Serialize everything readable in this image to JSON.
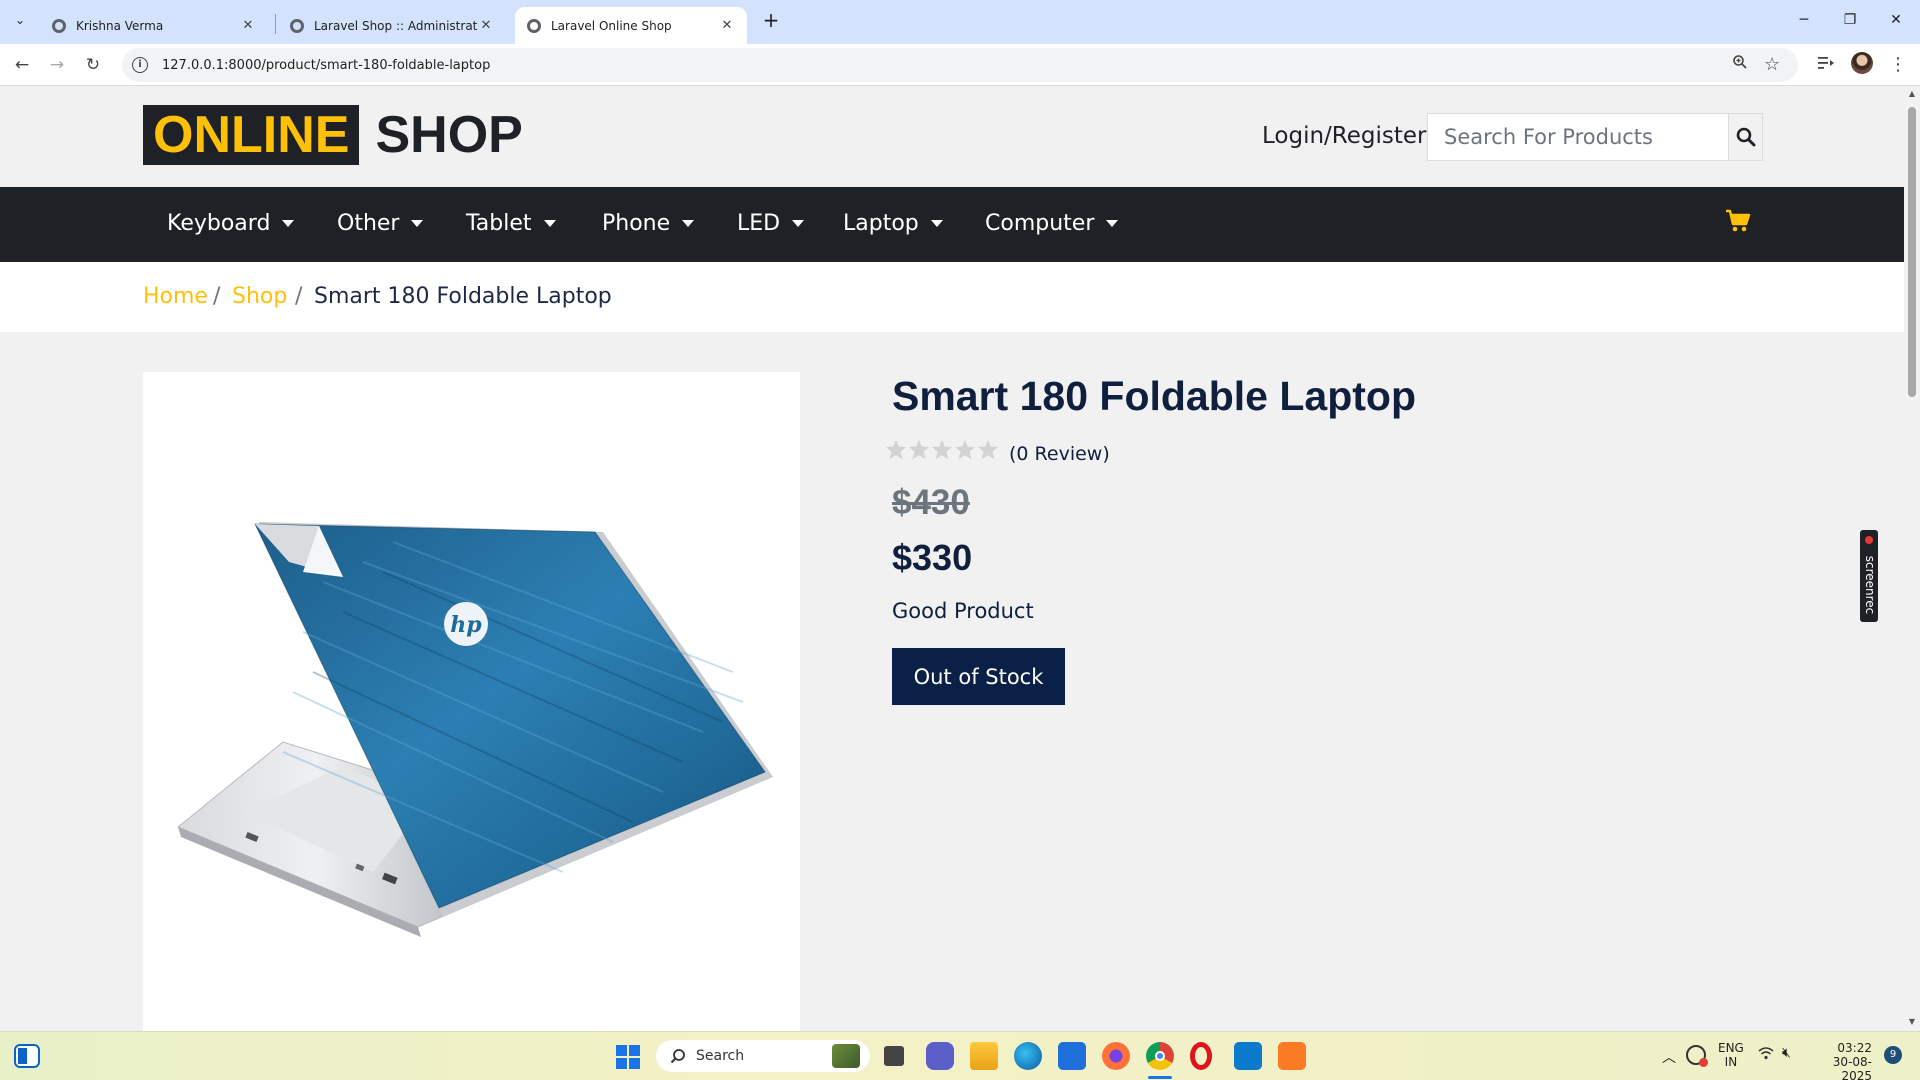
{
  "browser": {
    "tabs": [
      {
        "title": "Krishna Verma"
      },
      {
        "title": "Laravel Shop :: Administrative P"
      },
      {
        "title": "Laravel Online Shop"
      }
    ],
    "url": "127.0.0.1:8000/product/smart-180-foldable-laptop"
  },
  "site": {
    "logo_part1": "ONLINE",
    "logo_part2": "SHOP",
    "login_label": "Login/Register",
    "search_placeholder": "Search For Products",
    "nav": [
      "Keyboard",
      "Other",
      "Tablet",
      "Phone",
      "LED",
      "Laptop",
      "Computer"
    ],
    "breadcrumb": {
      "home": "Home",
      "shop": "Shop",
      "current": "Smart 180 Foldable Laptop",
      "sep": "/"
    }
  },
  "product": {
    "title": "Smart 180 Foldable Laptop",
    "rating": 0,
    "max_rating": 5,
    "review_text": "(0 Review)",
    "old_price": "$430",
    "price": "$330",
    "short_description": "Good Product",
    "stock_button": "Out of Stock",
    "image_logo": "hp"
  },
  "overlay": {
    "screenrec": "screenrec"
  },
  "taskbar": {
    "search_label": "Search",
    "lang_top": "ENG",
    "lang_bottom": "IN",
    "time": "03:22",
    "date": "30-08-2025",
    "notifications": "9"
  },
  "colors": {
    "accent": "#ffc107",
    "dark": "#1e2227",
    "navy": "#0a2046",
    "tabstrip": "#d3e3fd"
  }
}
